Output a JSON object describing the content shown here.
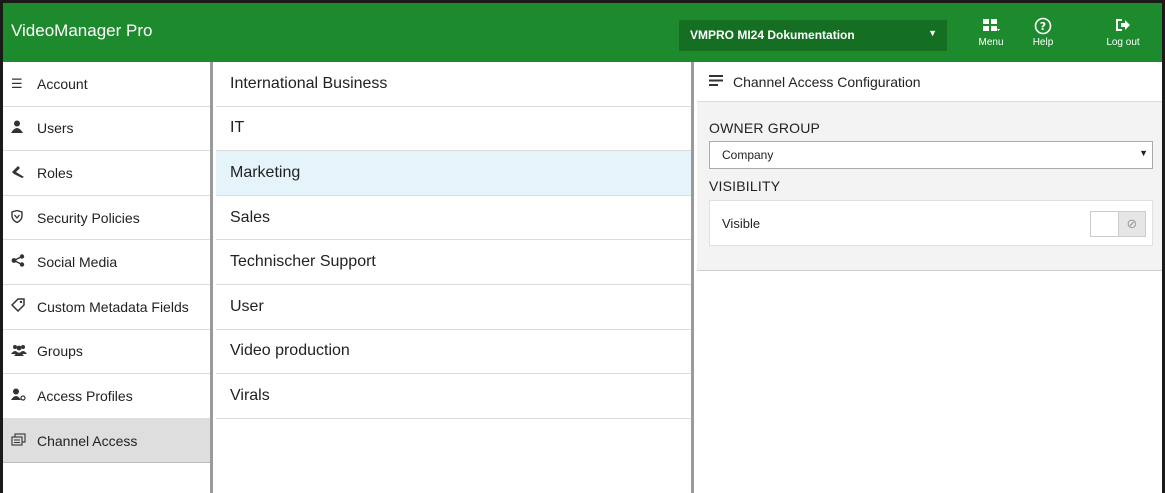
{
  "app": {
    "title": "VideoManager Pro"
  },
  "header": {
    "project_select": "VMPRO MI24 Dokumentation",
    "buttons": [
      {
        "label": "Menu",
        "icon": "grid-icon"
      },
      {
        "label": "Help",
        "icon": "help-circle-icon"
      },
      {
        "label": "Log out",
        "icon": "logout-icon"
      }
    ]
  },
  "leftnav": {
    "items": [
      {
        "label": "Account",
        "icon": "account-icon"
      },
      {
        "label": "Users",
        "icon": "user-icon"
      },
      {
        "label": "Roles",
        "icon": "roles-icon"
      },
      {
        "label": "Security Policies",
        "icon": "shield-icon"
      },
      {
        "label": "Social Media",
        "icon": "share-icon"
      },
      {
        "label": "Custom Metadata Fields",
        "icon": "tag-icon"
      },
      {
        "label": "Groups",
        "icon": "groups-icon"
      },
      {
        "label": "Access Profiles",
        "icon": "access-profile-icon"
      },
      {
        "label": "Channel Access",
        "icon": "channel-icon",
        "active": true
      }
    ]
  },
  "midlist": {
    "items": [
      "International Business",
      "IT",
      "Marketing",
      "Sales",
      "Technischer Support",
      "User",
      "Video production",
      "Virals"
    ],
    "selected": "Marketing"
  },
  "panel": {
    "title": "Channel Access Configuration",
    "owner_group_label": "OWNER GROUP",
    "owner_group_value": "Company",
    "visibility_label": "VISIBILITY",
    "visible_label": "Visible",
    "toggle_knob": "⊘"
  },
  "colors": {
    "header": "#1e8a2e",
    "header_dark": "#156f22",
    "selected": "#e5f3fb",
    "active_nav": "#dedede"
  }
}
